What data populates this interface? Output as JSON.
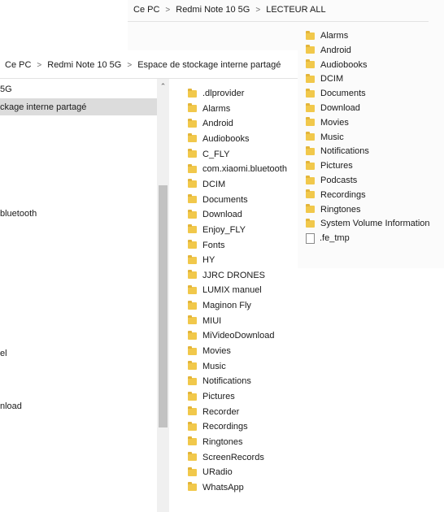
{
  "back_window": {
    "breadcrumb": [
      "Ce PC",
      "Redmi Note 10 5G",
      "LECTEUR ALL"
    ],
    "items": [
      {
        "name": "Alarms",
        "type": "folder"
      },
      {
        "name": "Android",
        "type": "folder"
      },
      {
        "name": "Audiobooks",
        "type": "folder"
      },
      {
        "name": "DCIM",
        "type": "folder"
      },
      {
        "name": "Documents",
        "type": "folder"
      },
      {
        "name": "Download",
        "type": "folder"
      },
      {
        "name": "Movies",
        "type": "folder"
      },
      {
        "name": "Music",
        "type": "folder"
      },
      {
        "name": "Notifications",
        "type": "folder"
      },
      {
        "name": "Pictures",
        "type": "folder"
      },
      {
        "name": "Podcasts",
        "type": "folder"
      },
      {
        "name": "Recordings",
        "type": "folder"
      },
      {
        "name": "Ringtones",
        "type": "folder"
      },
      {
        "name": "System Volume Information",
        "type": "folder"
      },
      {
        "name": ".fe_tmp",
        "type": "file"
      }
    ]
  },
  "front_window": {
    "breadcrumb": [
      "Ce PC",
      "Redmi Note 10 5G",
      "Espace de stockage interne partagé"
    ],
    "nav_pane": [
      "5G",
      "ckage interne partagé",
      "bluetooth",
      "el",
      "nload"
    ],
    "items": [
      ".dlprovider",
      "Alarms",
      "Android",
      "Audiobooks",
      "C_FLY",
      "com.xiaomi.bluetooth",
      "DCIM",
      "Documents",
      "Download",
      "Enjoy_FLY",
      "Fonts",
      "HY",
      "JJRC DRONES",
      "LUMIX manuel",
      "Maginon Fly",
      "MIUI",
      "MiVideoDownload",
      "Movies",
      "Music",
      "Notifications",
      "Pictures",
      "Recorder",
      "Recordings",
      "Ringtones",
      "ScreenRecords",
      "URadio",
      "WhatsApp"
    ]
  },
  "colors": {
    "folder": "#f1c84b",
    "selected_row": "#dcdcdc",
    "scrollbar_track": "#f0f0f0",
    "scrollbar_thumb": "#c2c2c2"
  }
}
